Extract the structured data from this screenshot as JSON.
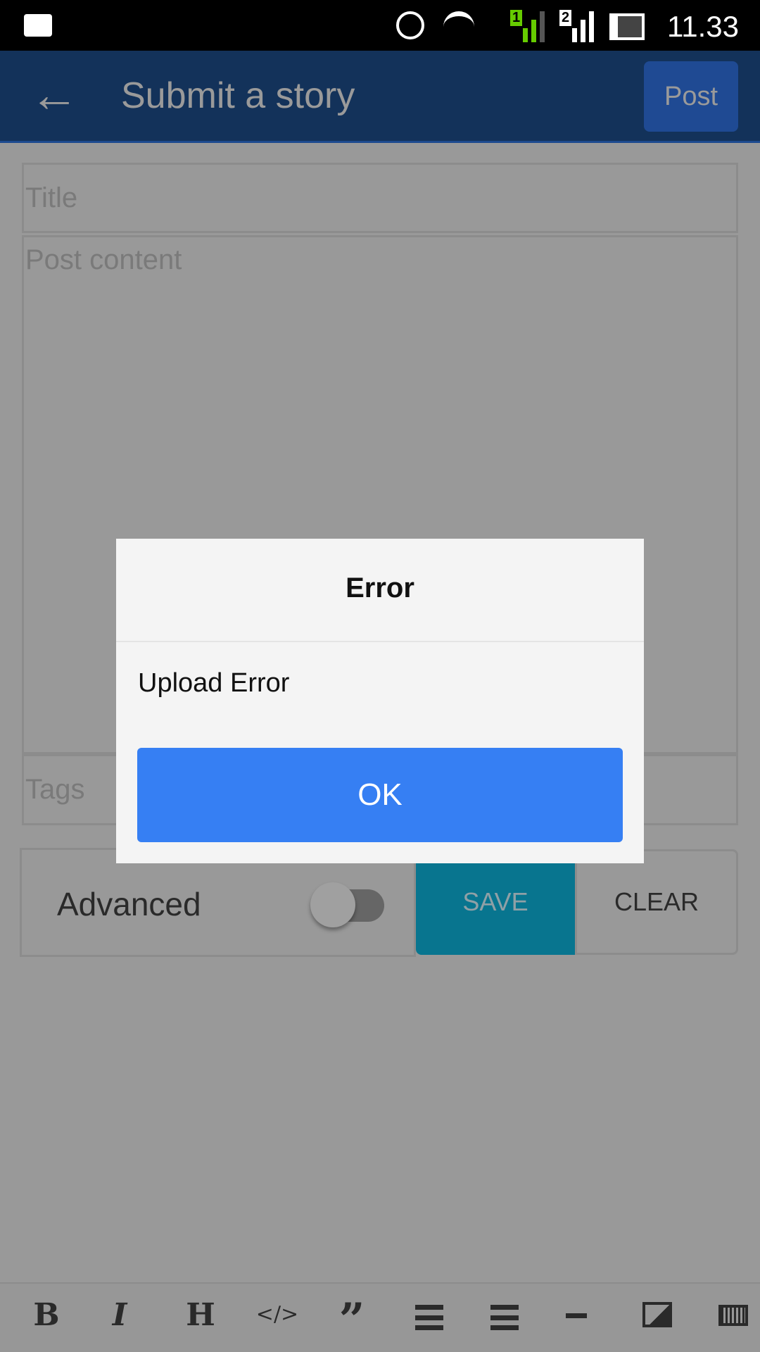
{
  "status_bar": {
    "time": "11.33",
    "sim1": "1",
    "sim2": "2",
    "icons": [
      "blackberry-messenger-icon",
      "alarm-icon",
      "wifi-icon",
      "signal-sim1-icon",
      "signal-sim2-icon",
      "battery-icon"
    ]
  },
  "app_bar": {
    "title": "Submit a story",
    "post_label": "Post",
    "back_icon": "arrow-left-icon"
  },
  "form": {
    "title_placeholder": "Title",
    "content_placeholder": "Post content",
    "tags_placeholder": "Tags",
    "advanced_label": "Advanced",
    "advanced_on": false,
    "save_label": "SAVE",
    "clear_label": "CLEAR"
  },
  "dialog": {
    "title": "Error",
    "message": "Upload Error",
    "ok_label": "OK"
  },
  "toolbar": {
    "bold": "B",
    "italic": "I",
    "heading": "H",
    "code": "</>",
    "quote": "”"
  },
  "colors": {
    "app_bar": "#13325a",
    "save": "#08758f",
    "ok": "#367ff3"
  }
}
